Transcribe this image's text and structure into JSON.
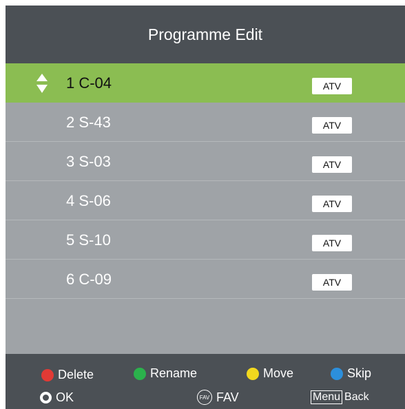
{
  "header": {
    "title": "Programme Edit"
  },
  "rows": [
    {
      "name": "1 C-04",
      "type": "ATV",
      "selected": true
    },
    {
      "name": "2 S-43",
      "type": "ATV",
      "selected": false
    },
    {
      "name": "3 S-03",
      "type": "ATV",
      "selected": false
    },
    {
      "name": "4 S-06",
      "type": "ATV",
      "selected": false
    },
    {
      "name": "5 S-10",
      "type": "ATV",
      "selected": false
    },
    {
      "name": "6 C-09",
      "type": "ATV",
      "selected": false
    }
  ],
  "footer": {
    "delete_label": "Delete",
    "rename_label": "Rename",
    "move_label": "Move",
    "skip_label": "Skip",
    "ok_label": "OK",
    "fav_icon_text": "FAV",
    "fav_label": "FAV",
    "menu_key": "Menu",
    "back_label": "Back"
  },
  "colors": {
    "selected_row": "#8bbd52",
    "delete": "#e23a35",
    "rename": "#2bb24c",
    "move": "#f2d81e",
    "skip": "#2c8fdc"
  }
}
